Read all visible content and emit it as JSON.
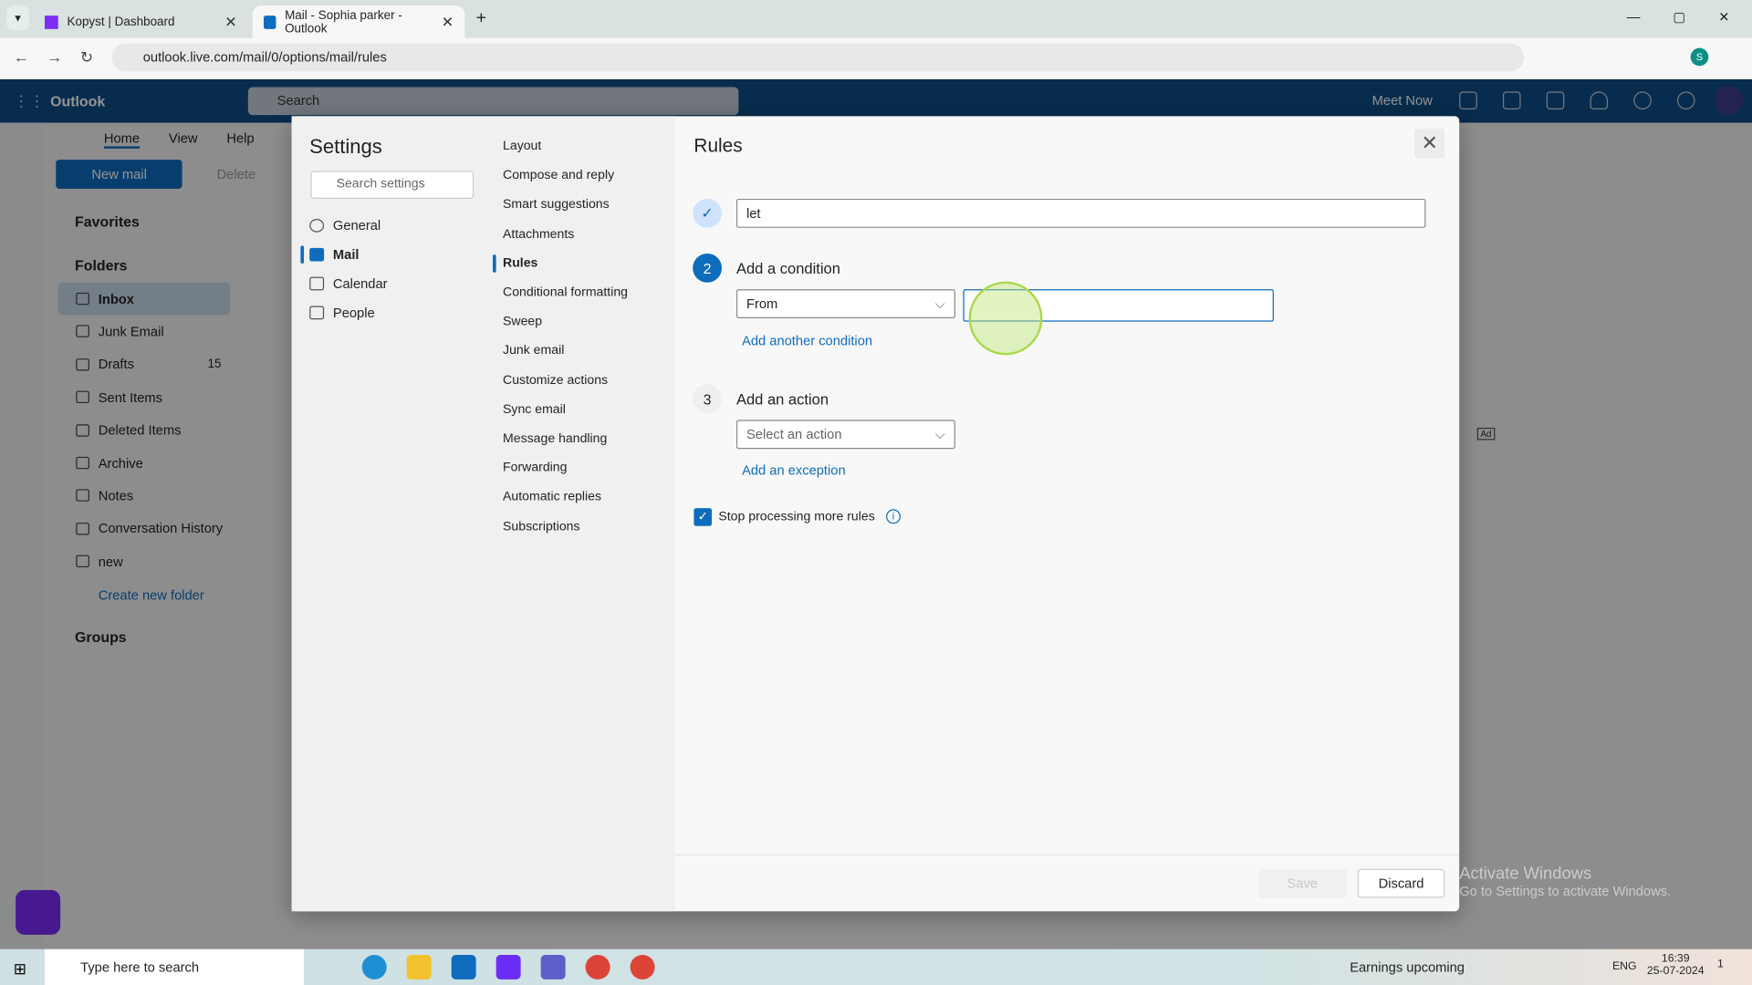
{
  "browser": {
    "tabs": [
      {
        "title": "Kopyst | Dashboard"
      },
      {
        "title": "Mail - Sophia parker - Outlook"
      }
    ],
    "url": "outlook.live.com/mail/0/options/mail/rules",
    "profile_initial": "S"
  },
  "outlook": {
    "app_name": "Outlook",
    "search_placeholder": "Search",
    "meet_now": "Meet Now",
    "ribbon_tabs": [
      "Home",
      "View",
      "Help"
    ],
    "new_mail": "New mail",
    "delete": "Delete",
    "favorites": "Favorites",
    "folders_label": "Folders",
    "groups": "Groups",
    "folders": [
      {
        "name": "Inbox",
        "icon": "inbox-icon"
      },
      {
        "name": "Junk Email",
        "icon": "junk-icon"
      },
      {
        "name": "Drafts",
        "count": "15",
        "icon": "drafts-icon"
      },
      {
        "name": "Sent Items",
        "icon": "sent-icon"
      },
      {
        "name": "Deleted Items",
        "icon": "trash-icon"
      },
      {
        "name": "Archive",
        "icon": "archive-icon"
      },
      {
        "name": "Notes",
        "icon": "notes-icon"
      },
      {
        "name": "Conversation History",
        "icon": "folder-icon"
      },
      {
        "name": "new",
        "icon": "folder-icon"
      }
    ],
    "create_folder": "Create new folder",
    "ad": "Ad"
  },
  "settings": {
    "title": "Settings",
    "search_placeholder": "Search settings",
    "categories": [
      {
        "label": "General",
        "icon": "gear-icon"
      },
      {
        "label": "Mail",
        "icon": "mail-icon",
        "active": true
      },
      {
        "label": "Calendar",
        "icon": "calendar-icon"
      },
      {
        "label": "People",
        "icon": "people-icon"
      }
    ],
    "mail_sections": [
      "Layout",
      "Compose and reply",
      "Smart suggestions",
      "Attachments",
      "Rules",
      "Conditional formatting",
      "Sweep",
      "Junk email",
      "Customize actions",
      "Sync email",
      "Message handling",
      "Forwarding",
      "Automatic replies",
      "Subscriptions"
    ],
    "active_section": "Rules"
  },
  "rules": {
    "title": "Rules",
    "rule_name": "let",
    "step2_number": "2",
    "step2_label": "Add a condition",
    "condition_select": "From",
    "condition_value": "",
    "add_condition": "Add another condition",
    "step3_number": "3",
    "step3_label": "Add an action",
    "action_placeholder": "Select an action",
    "add_exception": "Add an exception",
    "stop_processing": "Stop processing more rules",
    "stop_processing_checked": true,
    "save": "Save",
    "discard": "Discard"
  },
  "watermark": {
    "line1": "Activate Windows",
    "line2": "Go to Settings to activate Windows."
  },
  "taskbar": {
    "search_placeholder": "Type here to search",
    "news": "Earnings upcoming",
    "lang": "ENG",
    "time": "16:39",
    "date": "25-07-2024",
    "notifications": "1"
  },
  "colors": {
    "accent": "#0f6cbd",
    "header": "#0f4c86",
    "highlight": "#8fd400"
  }
}
